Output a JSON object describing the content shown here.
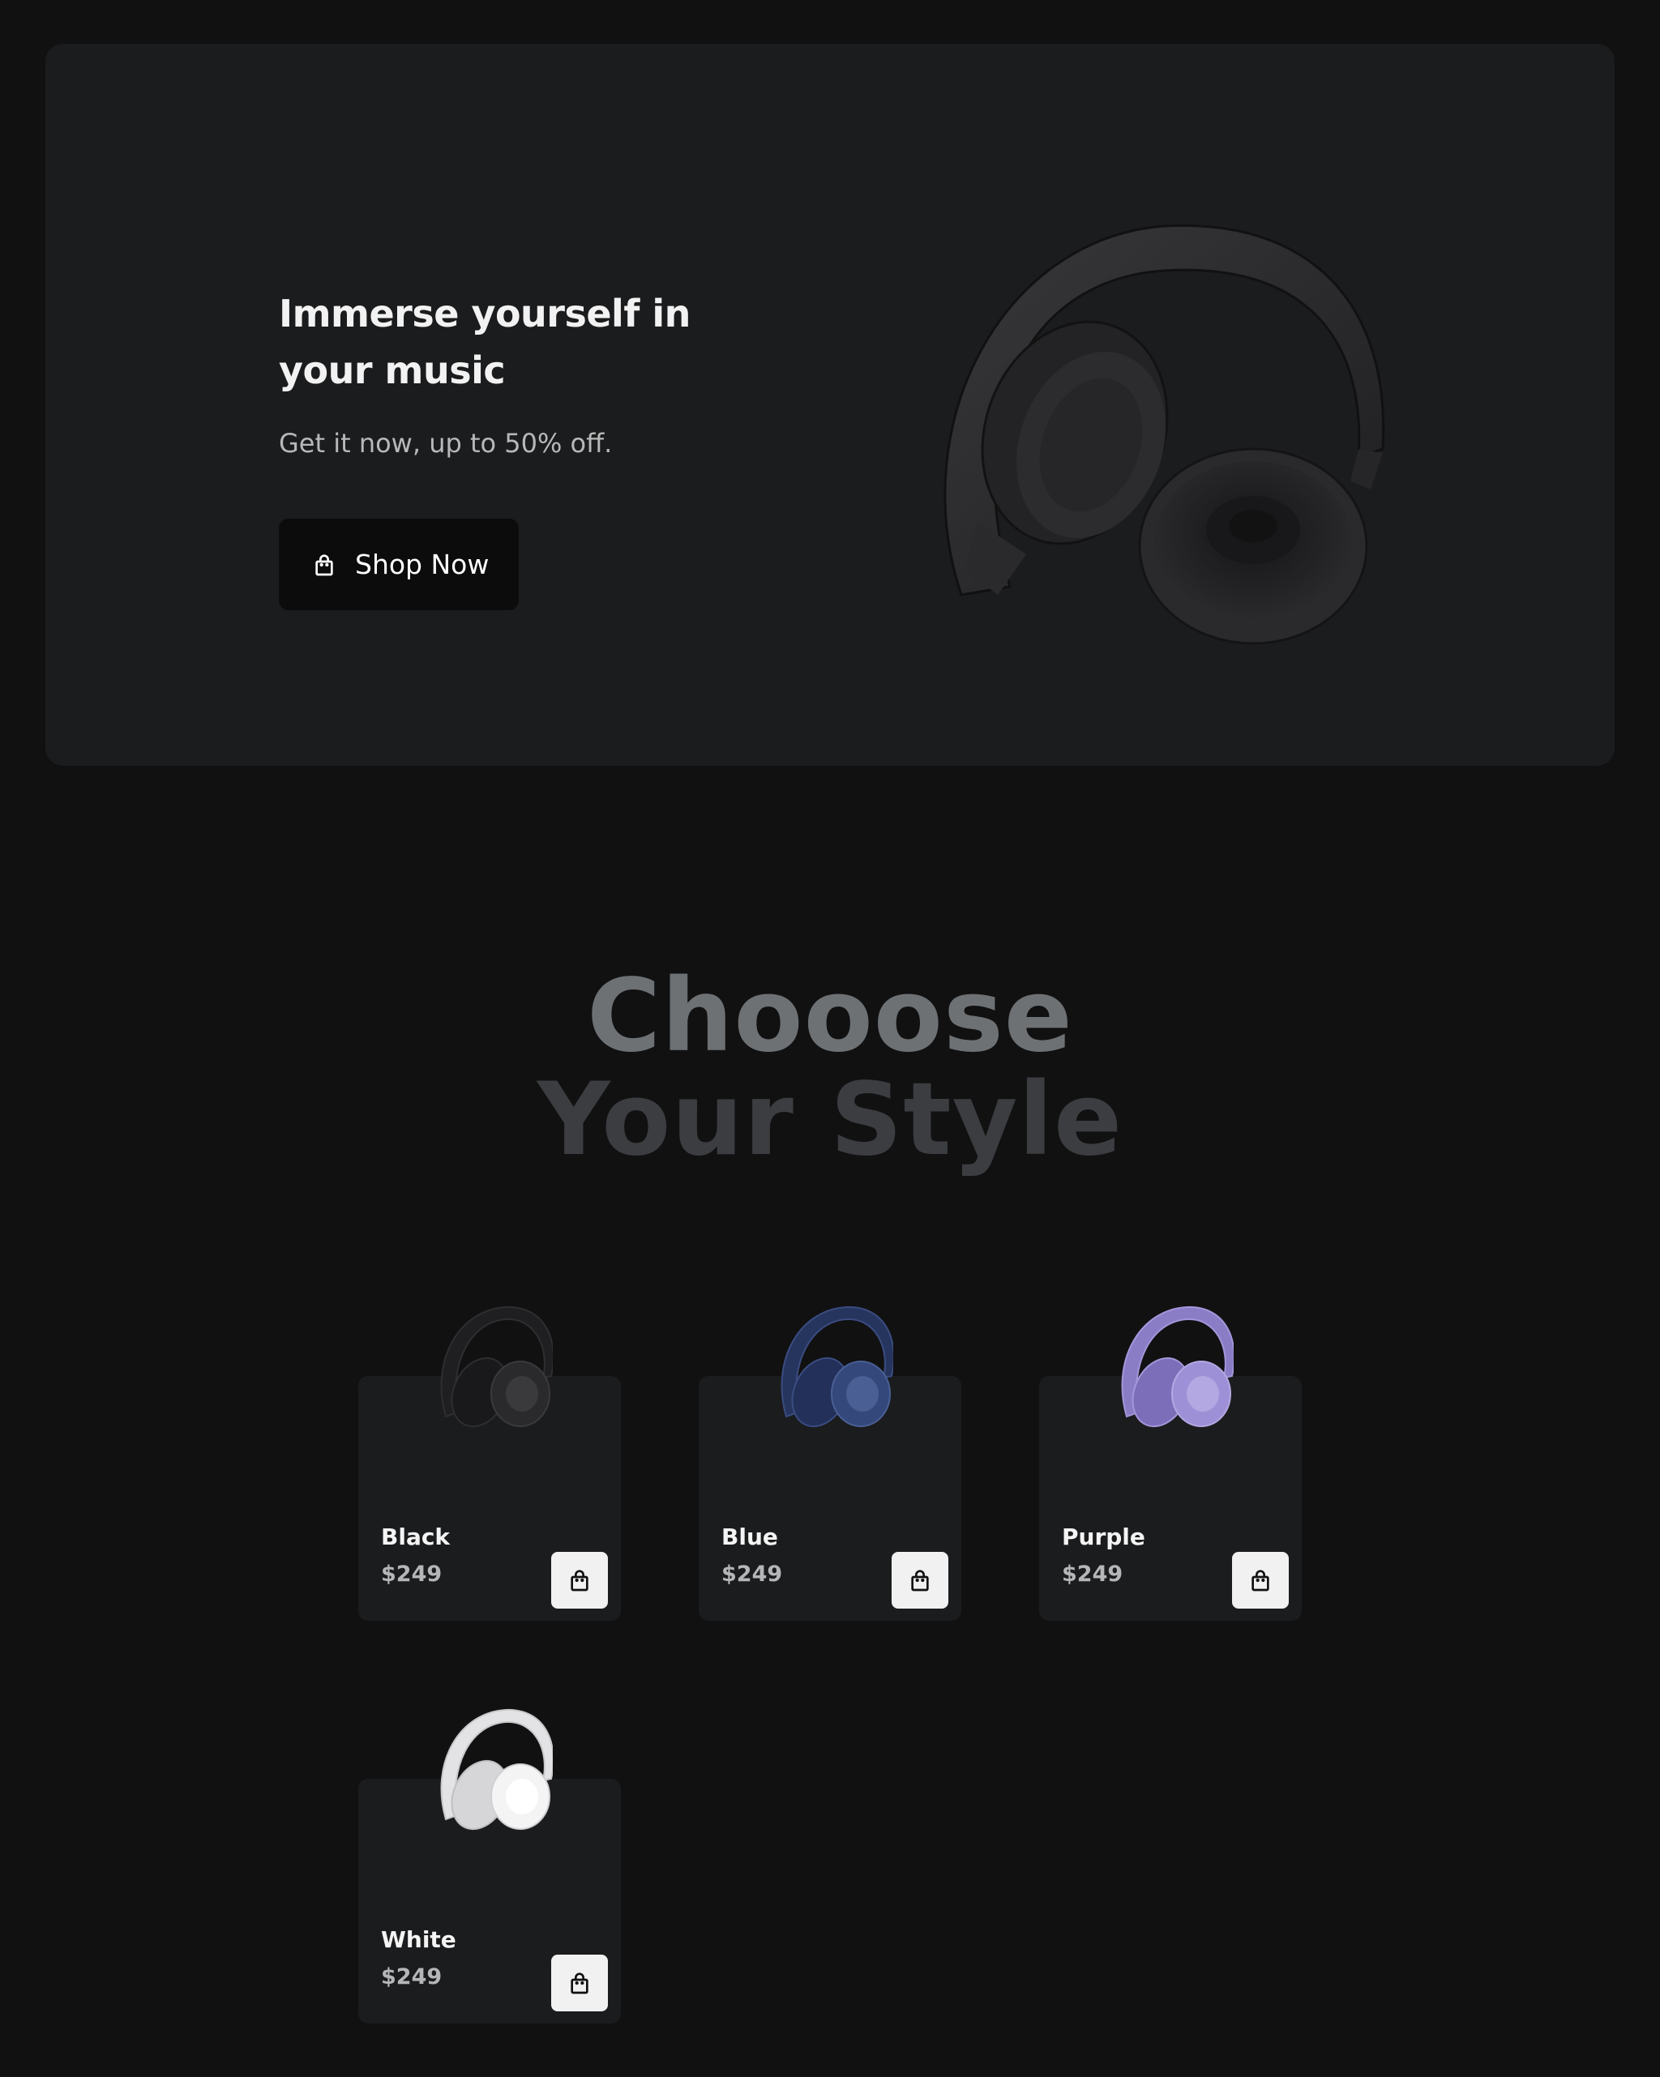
{
  "hero": {
    "title": "Immerse yourself in your music",
    "subtitle": "Get it now, up to 50% off.",
    "cta_label": "Shop Now",
    "cta_icon": "shopping-bag-icon"
  },
  "section": {
    "title_line1": "Chooose",
    "title_line2": "Your Style"
  },
  "products": [
    {
      "name": "Black",
      "price": "$249",
      "color": "#1f1f21",
      "accent": "#3a3a3d",
      "cart_icon": "shopping-bag-icon"
    },
    {
      "name": "Blue",
      "price": "$249",
      "color": "#2a3a66",
      "accent": "#4a5f94",
      "cart_icon": "shopping-bag-icon"
    },
    {
      "name": "Purple",
      "price": "$249",
      "color": "#8f80c9",
      "accent": "#b3a8e2",
      "cart_icon": "shopping-bag-icon"
    },
    {
      "name": "White",
      "price": "$249",
      "color": "#e8e8ea",
      "accent": "#ffffff",
      "cart_icon": "shopping-bag-icon"
    }
  ],
  "colors": {
    "page_bg": "#111112",
    "card_bg": "#1b1c1e",
    "button_dark": "#0c0c0d",
    "button_light": "#f1f1f1"
  }
}
